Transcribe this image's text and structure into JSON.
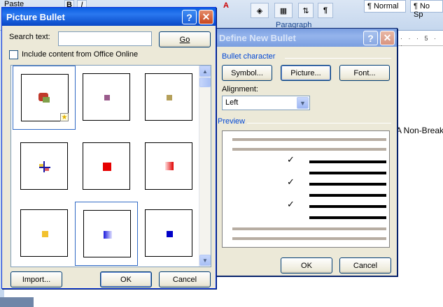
{
  "word": {
    "ribbon": {
      "paste_label": "Paste",
      "paragraph_group_label": "Paragraph",
      "styles": [
        "¶ Normal",
        "¶ No Sp"
      ]
    },
    "ruler_text": "· · · 5 · ·",
    "document_text": "A Non-Break"
  },
  "define_new_bullet": {
    "title": "Define New Bullet",
    "section_bullet_character": "Bullet character",
    "buttons": {
      "symbol": "Symbol...",
      "picture": "Picture...",
      "font": "Font..."
    },
    "alignment_label": "Alignment:",
    "alignment_value": "Left",
    "section_preview": "Preview",
    "preview_check_glyph": "✓",
    "ok": "OK",
    "cancel": "Cancel"
  },
  "picture_bullet": {
    "title": "Picture Bullet",
    "search_label": "Search text:",
    "search_value": "",
    "go_label": "Go",
    "include_online_label": "Include content from Office Online",
    "include_online_checked": false,
    "items": [
      {
        "name": "picture-bullet-clipart",
        "colors": [
          "#c0392b",
          "#7fa04a"
        ],
        "selected": true
      },
      {
        "name": "picture-bullet-purple",
        "colors": [
          "#9a5b8c"
        ]
      },
      {
        "name": "picture-bullet-olive",
        "colors": [
          "#b5a05a"
        ]
      },
      {
        "name": "picture-bullet-cross",
        "colors": [
          "#1a1aa8",
          "#e6c33a"
        ]
      },
      {
        "name": "picture-bullet-red-square",
        "colors": [
          "#e60000"
        ]
      },
      {
        "name": "picture-bullet-red-gradient",
        "colors": [
          "#e00000",
          "#ffe0e0"
        ]
      },
      {
        "name": "picture-bullet-yellow-square",
        "colors": [
          "#f2c12e"
        ]
      },
      {
        "name": "picture-bullet-blue-gradient",
        "colors": [
          "#1a1adc",
          "#e0e0ff"
        ],
        "focused": true
      },
      {
        "name": "picture-bullet-blue-square",
        "colors": [
          "#0000c8"
        ]
      }
    ],
    "import_label": "Import...",
    "ok": "OK",
    "cancel": "Cancel",
    "help_glyph": "?",
    "close_glyph": "✕"
  },
  "colors": {
    "xp_title_blue": "#0a5ce0",
    "dialog_face": "#ece9d8",
    "group_label_blue": "#0046d5"
  }
}
